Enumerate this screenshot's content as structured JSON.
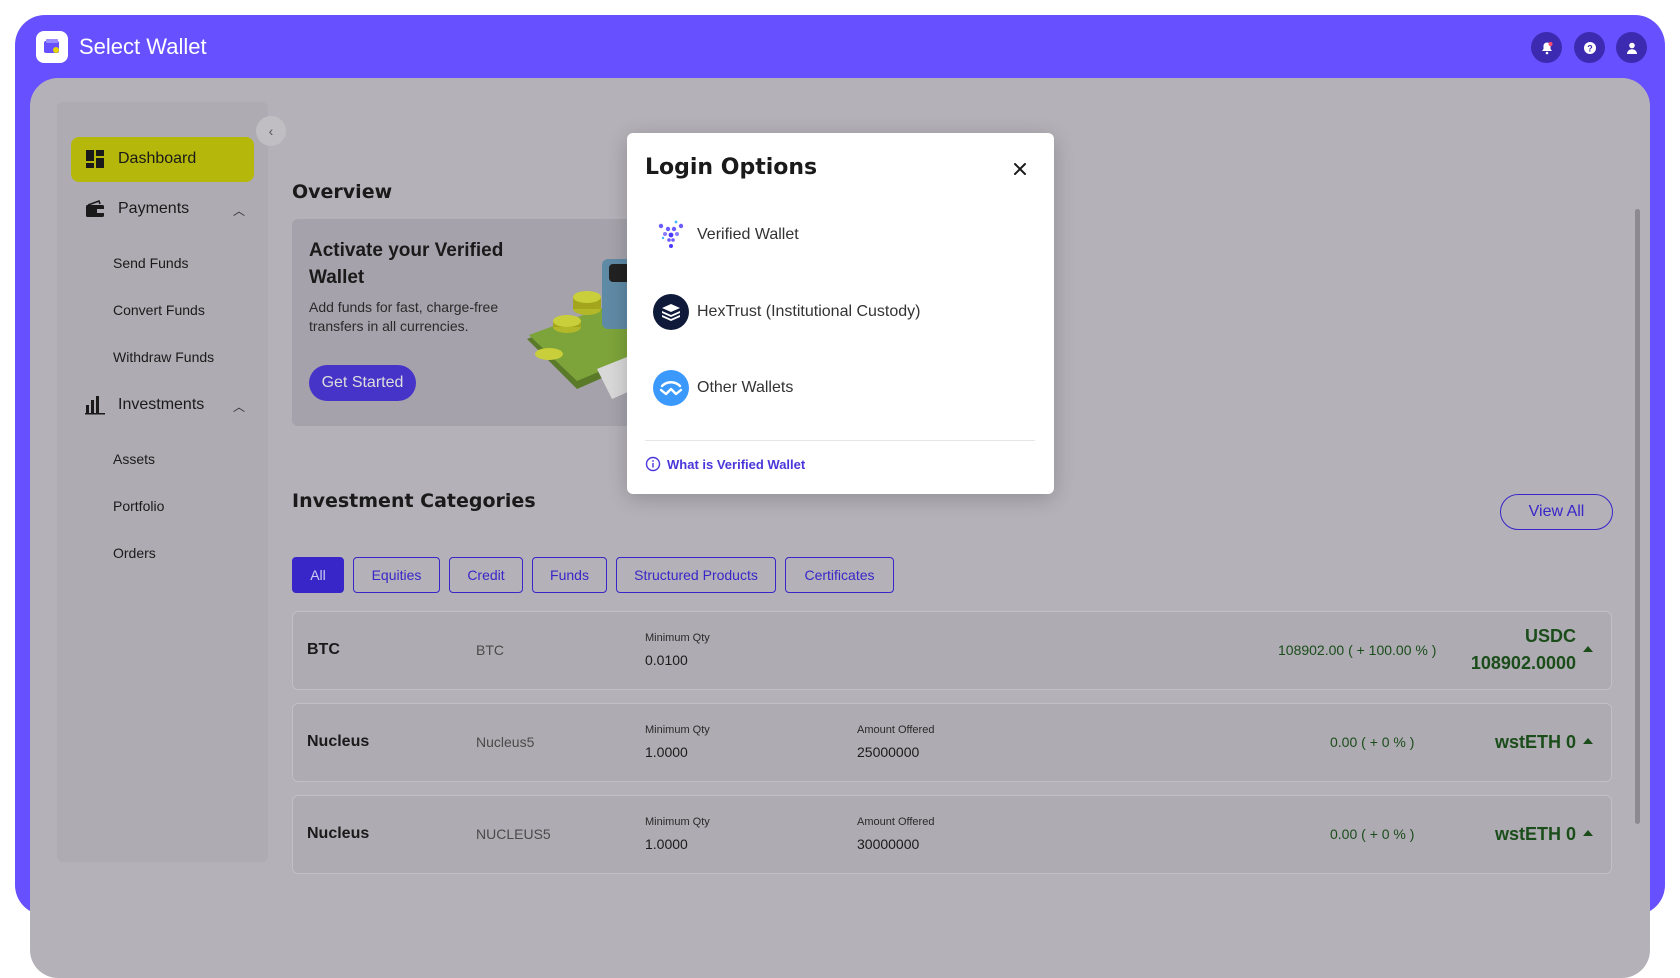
{
  "app": {
    "title": "Select Wallet"
  },
  "top_actions": [
    "bell-icon",
    "help-icon",
    "user-icon"
  ],
  "sidebar": {
    "items": [
      {
        "label": "Dashboard",
        "icon": "dashboard-icon",
        "active": true
      },
      {
        "label": "Payments",
        "icon": "wallet-icon",
        "expanded": true,
        "children": [
          "Send Funds",
          "Convert Funds",
          "Withdraw Funds"
        ]
      },
      {
        "label": "Investments",
        "icon": "bar-chart-icon",
        "expanded": true,
        "children": [
          "Assets",
          "Portfolio",
          "Orders"
        ]
      }
    ]
  },
  "overview": {
    "title": "Overview",
    "promo": {
      "title": "Activate your Verified Wallet",
      "text": "Add funds for fast, charge-free transfers in all currencies.",
      "button": "Get Started"
    }
  },
  "categories": {
    "title": "Investment Categories",
    "view_all": "View All",
    "chips": [
      "All",
      "Equities",
      "Credit",
      "Funds",
      "Structured Products",
      "Certificates"
    ],
    "active_chip": "All"
  },
  "rows": [
    {
      "name": "BTC",
      "symbol": "BTC",
      "min_qty_label": "Minimum Qty",
      "min_qty": "0.0100",
      "amount_label": "",
      "amount": "",
      "change": "108902.00 ( + 100.00 % )",
      "price_line1": "USDC",
      "price_line2": "108902.0000"
    },
    {
      "name": "Nucleus",
      "symbol": "Nucleus5",
      "min_qty_label": "Minimum Qty",
      "min_qty": "1.0000",
      "amount_label": "Amount Offered",
      "amount": "25000000",
      "change": "0.00 ( + 0 % )",
      "price_line1": "wstETH 0",
      "price_line2": ""
    },
    {
      "name": "Nucleus",
      "symbol": "NUCLEUS5",
      "min_qty_label": "Minimum Qty",
      "min_qty": "1.0000",
      "amount_label": "Amount Offered",
      "amount": "30000000",
      "change": "0.00 ( + 0 % )",
      "price_line1": "wstETH 0",
      "price_line2": ""
    }
  ],
  "modal": {
    "title": "Login Options",
    "options": [
      {
        "label": "Verified Wallet",
        "icon": "verified-wallet-icon"
      },
      {
        "label": "HexTrust (Institutional Custody)",
        "icon": "hextrust-icon"
      },
      {
        "label": "Other Wallets",
        "icon": "walletconnect-icon"
      }
    ],
    "help_link": "What is Verified Wallet"
  },
  "colors": {
    "brand": "#6650ff",
    "accent": "#3826c9",
    "active_nav": "#b5b80a",
    "positive": "#1b4d1b"
  }
}
